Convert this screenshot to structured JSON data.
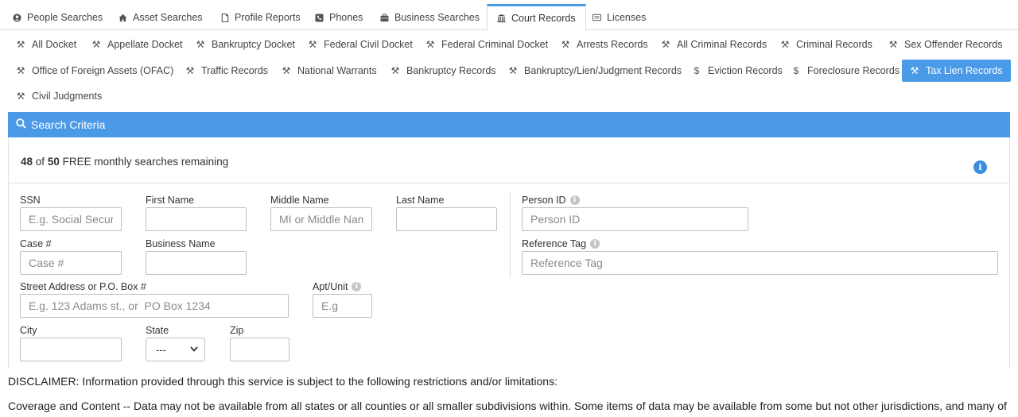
{
  "top_tabs": [
    {
      "label": "People Searches",
      "icon": "user-circle-icon"
    },
    {
      "label": "Asset Searches",
      "icon": "home-icon"
    },
    {
      "label": "Profile Reports",
      "icon": "document-icon"
    },
    {
      "label": "Phones",
      "icon": "phone-icon"
    },
    {
      "label": "Business Searches",
      "icon": "briefcase-icon"
    },
    {
      "label": "Court Records",
      "icon": "courthouse-icon",
      "active": true
    },
    {
      "label": "Licenses",
      "icon": "id-card-icon"
    }
  ],
  "sub_tabs": [
    {
      "label": "All Docket",
      "icon": "gavel-icon"
    },
    {
      "label": "Appellate Docket",
      "icon": "gavel-icon"
    },
    {
      "label": "Bankruptcy Docket",
      "icon": "gavel-icon"
    },
    {
      "label": "Federal Civil Docket",
      "icon": "gavel-icon"
    },
    {
      "label": "Federal Criminal Docket",
      "icon": "gavel-icon"
    },
    {
      "label": "Arrests Records",
      "icon": "gavel-icon"
    },
    {
      "label": "All Criminal Records",
      "icon": "gavel-icon"
    },
    {
      "label": "Criminal Records",
      "icon": "gavel-icon"
    },
    {
      "label": "Sex Offender Records",
      "icon": "gavel-icon"
    },
    {
      "label": "Office of Foreign Assets (OFAC)",
      "icon": "gavel-icon"
    },
    {
      "label": "Traffic Records",
      "icon": "gavel-icon"
    },
    {
      "label": "National Warrants",
      "icon": "gavel-icon"
    },
    {
      "label": "Bankruptcy Records",
      "icon": "gavel-icon"
    },
    {
      "label": "Bankruptcy/Lien/Judgment Records",
      "icon": "gavel-icon"
    },
    {
      "label": "Eviction Records",
      "icon": "dollar-icon"
    },
    {
      "label": "Foreclosure Records",
      "icon": "dollar-icon"
    },
    {
      "label": "Tax Lien Records",
      "icon": "gavel-icon",
      "active": true
    },
    {
      "label": "Civil Judgments",
      "icon": "gavel-icon"
    }
  ],
  "panel": {
    "title": "Search Criteria",
    "remaining_used": "48",
    "remaining_of": "of",
    "remaining_total": "50",
    "remaining_text": "FREE monthly searches remaining"
  },
  "form": {
    "ssn": {
      "label": "SSN",
      "placeholder": "E.g. Social Security #",
      "value": ""
    },
    "first_name": {
      "label": "First Name",
      "placeholder": "",
      "value": ""
    },
    "middle_name": {
      "label": "Middle Name",
      "placeholder": "MI or Middle Name",
      "value": ""
    },
    "last_name": {
      "label": "Last Name",
      "placeholder": "",
      "value": ""
    },
    "person_id": {
      "label": "Person ID",
      "placeholder": "Person ID",
      "value": ""
    },
    "case_no": {
      "label": "Case #",
      "placeholder": "Case #",
      "value": ""
    },
    "business_name": {
      "label": "Business Name",
      "placeholder": "",
      "value": ""
    },
    "reference_tag": {
      "label": "Reference Tag",
      "placeholder": "Reference Tag",
      "value": ""
    },
    "street": {
      "label": "Street Address or P.O. Box #",
      "placeholder": "E.g. 123 Adams st., or  PO Box 1234",
      "value": ""
    },
    "apt": {
      "label": "Apt/Unit",
      "placeholder": "E.g",
      "value": ""
    },
    "city": {
      "label": "City",
      "placeholder": "",
      "value": ""
    },
    "state": {
      "label": "State",
      "selected": "---"
    },
    "zip": {
      "label": "Zip",
      "placeholder": "",
      "value": ""
    }
  },
  "disclaimer": "DISCLAIMER: Information provided through this service is subject to the following restrictions and/or limitations:",
  "coverage": "Coverage and Content -- Data may not be available from all states or all counties or all smaller subdivisions within. Some items of data may be available from some but not other jurisdictions, and many of"
}
